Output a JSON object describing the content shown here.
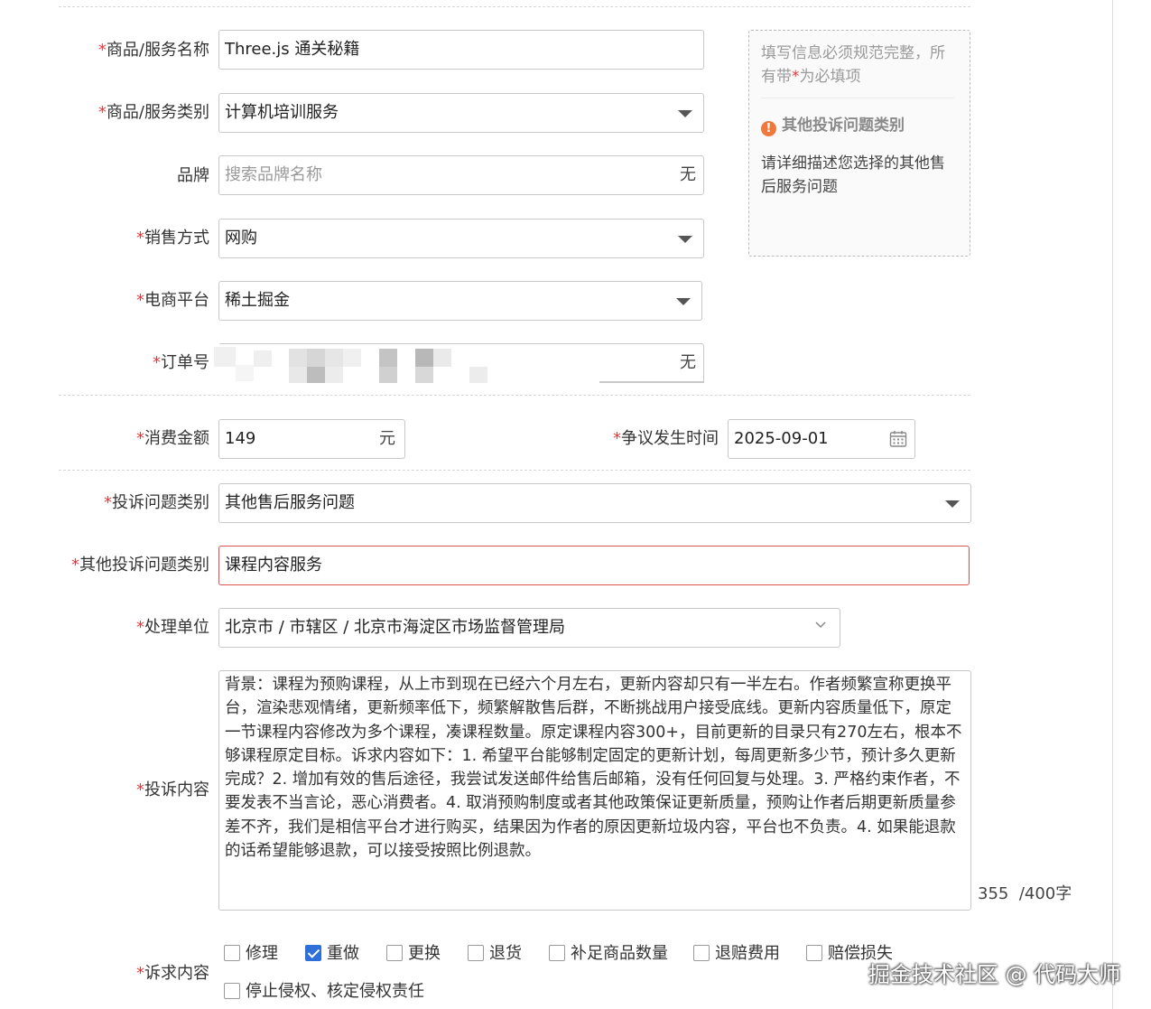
{
  "form": {
    "required_mark": "*",
    "product_name": {
      "label": "商品/服务名称",
      "value": "Three.js 通关秘籍"
    },
    "product_category": {
      "label": "商品/服务类别",
      "value": "计算机培训服务"
    },
    "brand": {
      "label": "品牌",
      "placeholder": "搜索品牌名称",
      "suffix": "无"
    },
    "sales_method": {
      "label": "销售方式",
      "value": "网购"
    },
    "platform": {
      "label": "电商平台",
      "value": "稀土掘金"
    },
    "order_no": {
      "label": "订单号",
      "suffix": "无"
    },
    "amount": {
      "label": "消费金额",
      "value": "149",
      "unit": "元"
    },
    "dispute_date": {
      "label": "争议发生时间",
      "value": "2025-09-01"
    },
    "complaint_type": {
      "label": "投诉问题类别",
      "value": "其他售后服务问题"
    },
    "other_complaint_type": {
      "label": "其他投诉问题类别",
      "value": "课程内容服务"
    },
    "handling_unit": {
      "label": "处理单位",
      "value": "北京市 / 市辖区 / 北京市海淀区市场监督管理局"
    },
    "complaint_content": {
      "label": "投诉内容",
      "value": "背景：课程为预购课程，从上市到现在已经六个月左右，更新内容却只有一半左右。作者频繁宣称更换平台，渲染悲观情绪，更新频率低下，频繁解散售后群，不断挑战用户接受底线。更新内容质量低下，原定一节课程内容修改为多个课程，凑课程数量。原定课程内容300+，目前更新的目录只有270左右，根本不够课程原定目标。诉求内容如下：1. 希望平台能够制定固定的更新计划，每周更新多少节，预计多久更新完成？2. 增加有效的售后途径，我尝试发送邮件给售后邮箱，没有任何回复与处理。3. 严格约束作者，不要发表不当言论，恶心消费者。4. 取消预购制度或者其他政策保证更新质量，预购让作者后期更新质量参差不齐，我们是相信平台才进行购买，结果因为作者的原因更新垃圾内容，平台也不负责。4. 如果能退款的话希望能够退款，可以接受按照比例退款。",
      "count": "355",
      "limit": "/400字"
    },
    "demands": {
      "label": "诉求内容",
      "options": [
        {
          "label": "修理",
          "checked": false
        },
        {
          "label": "重做",
          "checked": true
        },
        {
          "label": "更换",
          "checked": false
        },
        {
          "label": "退货",
          "checked": false
        },
        {
          "label": "补足商品数量",
          "checked": false
        },
        {
          "label": "退赔费用",
          "checked": false
        },
        {
          "label": "赔偿损失",
          "checked": false
        },
        {
          "label": "停止侵权、核定侵权责任",
          "checked": false
        }
      ]
    }
  },
  "tip": {
    "intro_before": "填写信息必须规范完整，所有带",
    "intro_mark": "*",
    "intro_after": "为必填项",
    "title": "其他投诉问题类别",
    "title_icon": "!",
    "body": "请详细描述您选择的其他售后服务问题"
  },
  "watermark": "掘金技术社区 @ 代码大师",
  "colors": {
    "required": "#e5393c",
    "accent": "#2f6fd8",
    "warning": "#f0783c",
    "error_border": "#d9534f"
  }
}
